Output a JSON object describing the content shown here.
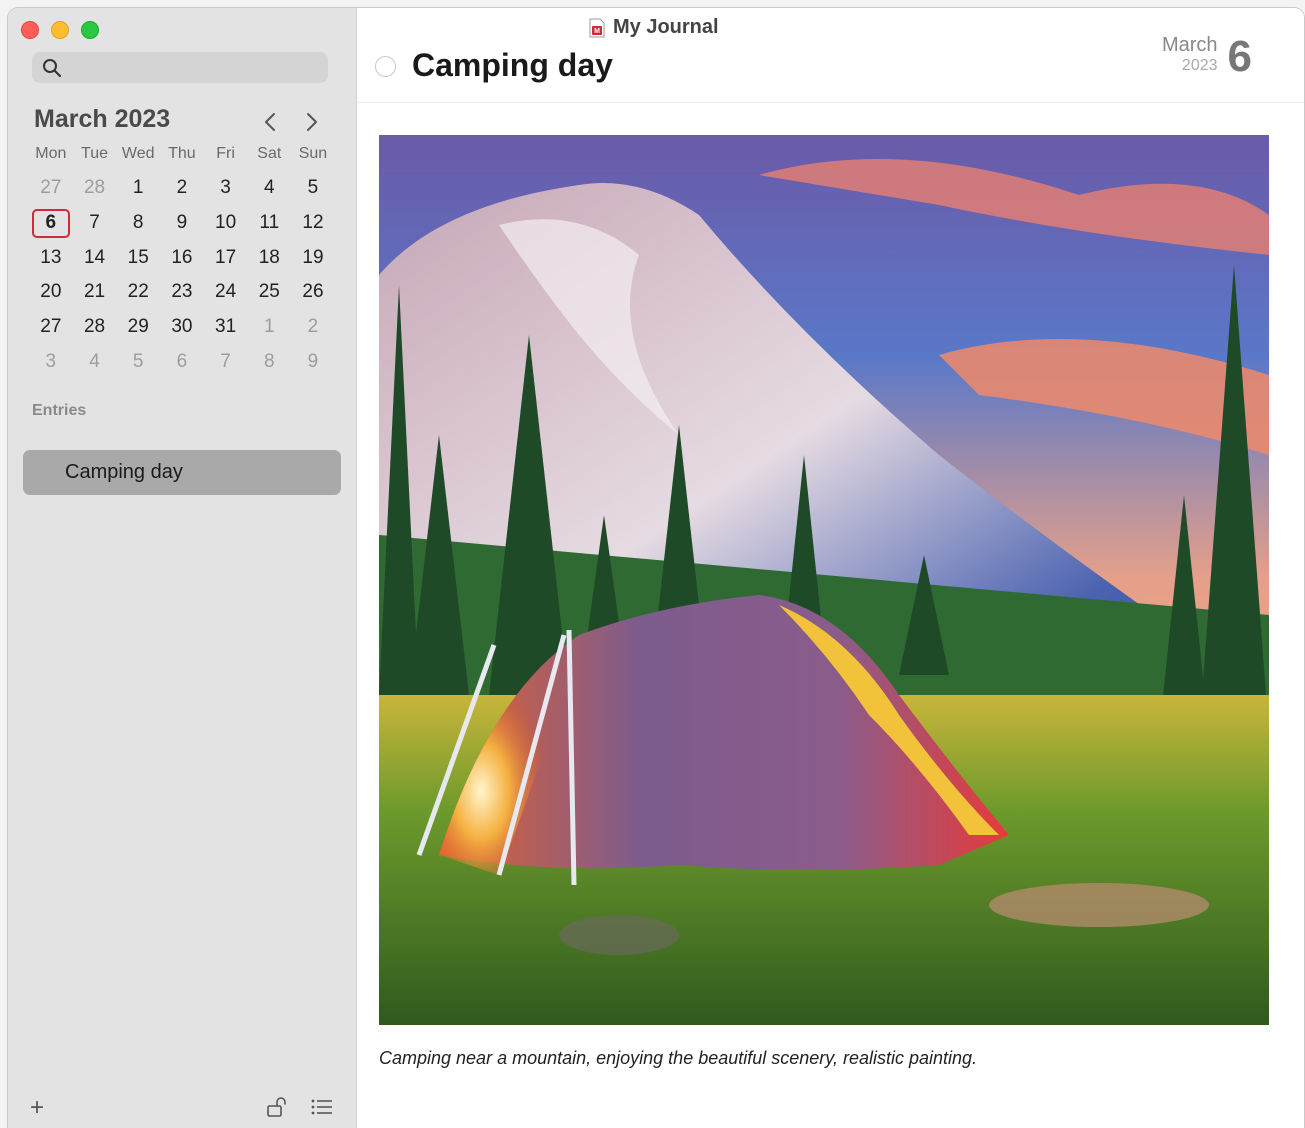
{
  "window": {
    "title": "My Journal"
  },
  "sidebar": {
    "search": {
      "placeholder": ""
    },
    "calendar": {
      "title": "March 2023",
      "weekdays": [
        "Mon",
        "Tue",
        "Wed",
        "Thu",
        "Fri",
        "Sat",
        "Sun"
      ],
      "weeks": [
        [
          "27",
          "28",
          "1",
          "2",
          "3",
          "4",
          "5"
        ],
        [
          "6",
          "7",
          "8",
          "9",
          "10",
          "11",
          "12"
        ],
        [
          "13",
          "14",
          "15",
          "16",
          "17",
          "18",
          "19"
        ],
        [
          "20",
          "21",
          "22",
          "23",
          "24",
          "25",
          "26"
        ],
        [
          "27",
          "28",
          "29",
          "30",
          "31",
          "1",
          "2"
        ],
        [
          "3",
          "4",
          "5",
          "6",
          "7",
          "8",
          "9"
        ]
      ],
      "selected_day": "6"
    },
    "entries_label": "Entries",
    "entries": [
      {
        "label": "Camping day"
      }
    ],
    "bottom": {
      "add_label": "+"
    }
  },
  "entry": {
    "title": "Camping day",
    "date_month": "March",
    "date_year": "2023",
    "date_day": "6",
    "caption": "Camping near a mountain, enjoying the beautiful scenery, realistic painting."
  },
  "colors": {
    "accent": "#d4273c",
    "sidebar_bg": "#e3e3e3",
    "selected_entry": "#a9a9a9"
  }
}
